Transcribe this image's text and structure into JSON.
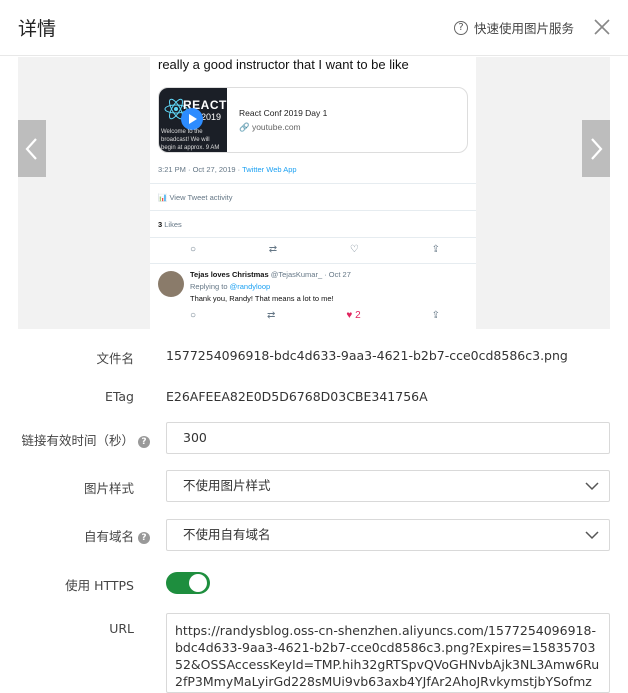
{
  "header": {
    "title": "详情",
    "help_label": "快速使用图片服务",
    "help_icon": "?"
  },
  "preview": {
    "tweet_text": "really a good instructor that I want to be like",
    "card_image_title": "REACT",
    "card_image_year": "2019",
    "card_image_caption": "Welcome to the broadcast! We will begin at approx. 9 AM",
    "card_title": "React Conf 2019 Day 1",
    "card_domain": "youtube.com",
    "time_text": "3:21 PM · Oct 27, 2019 · ",
    "time_source": "Twitter Web App",
    "activity_text": "View Tweet activity",
    "likes_count": "3",
    "likes_label": " Likes",
    "reply_name": "Tejas loves Christmas",
    "reply_handle": " @TejasKumar_ · Oct 27",
    "reply_to_prefix": "Replying to ",
    "reply_to_handle": "@randyloop",
    "reply_text": "Thank you, Randy! That means a lot to me!",
    "reply_like_count": "2"
  },
  "fields": {
    "filename_label": "文件名",
    "filename_value": "1577254096918-bdc4d633-9aa3-4621-b2b7-cce0cd8586c3.png",
    "etag_label": "ETag",
    "etag_value": "E26AFEEA82E0D5D6768D03CBE341756A",
    "expire_label": "链接有效时间（秒）",
    "expire_value": "300",
    "style_label": "图片样式",
    "style_value": "不使用图片样式",
    "domain_label": "自有域名",
    "domain_value": "不使用自有域名",
    "https_label": "使用 HTTPS",
    "https_enabled": true,
    "url_label": "URL",
    "url_value": "https://randysblog.oss-cn-shenzhen.aliyuncs.com/1577254096918-bdc4d633-9aa3-4621-b2b7-cce0cd8586c3.png?Expires=1583570352&OSSAccessKeyId=TMP.hih32gRTSpvQVoGHNvbAjk3NL3Amw6Ru2fP3MmyMaLyirGd228sMUi9vb63axb4YJfAr2AhoJRvkymstjbYSofmzDJqA"
  },
  "colors": {
    "toggle_on": "#1e8e3e",
    "twitter_blue": "#1da1f2",
    "heart_red": "#e0245e"
  }
}
